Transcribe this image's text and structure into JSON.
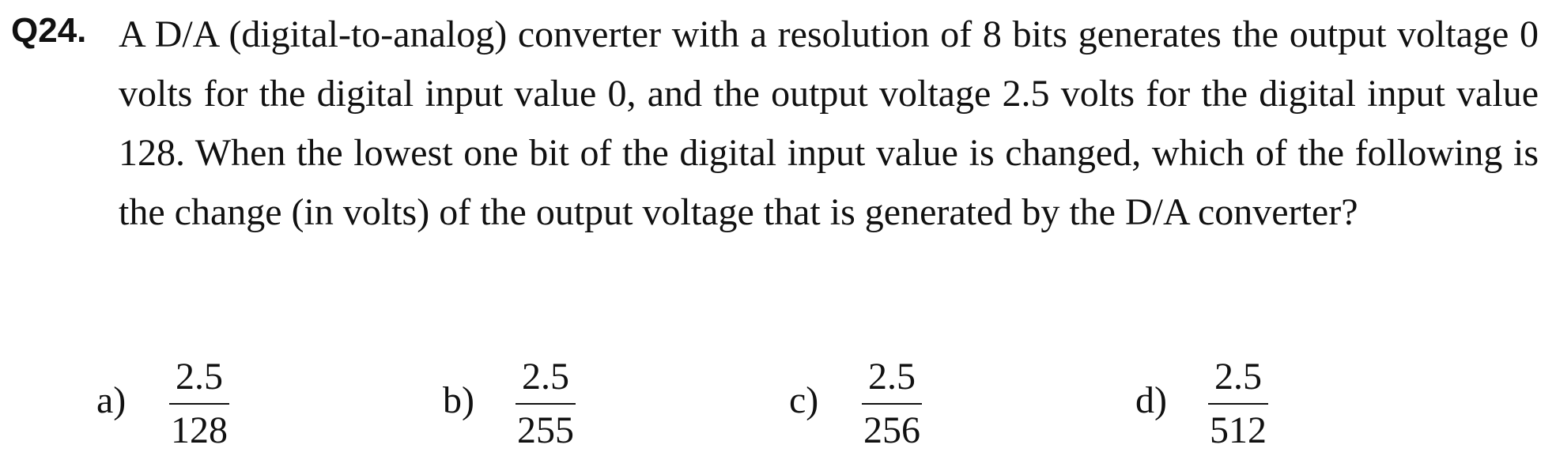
{
  "question": {
    "number": "Q24.",
    "text": "A D/A (digital-to-analog) converter with a resolution of 8 bits generates the output voltage 0 volts for the digital input value 0, and the output voltage 2.5 volts for the digital input value 128.   When the lowest one bit of the digital input value is changed, which of the following is the change (in volts) of the output voltage that is generated by the D/A converter?"
  },
  "choices": [
    {
      "letter": "a)",
      "numerator": "2.5",
      "denominator": "128"
    },
    {
      "letter": "b)",
      "numerator": "2.5",
      "denominator": "255"
    },
    {
      "letter": "c)",
      "numerator": "2.5",
      "denominator": "256"
    },
    {
      "letter": "d)",
      "numerator": "2.5",
      "denominator": "512"
    }
  ]
}
